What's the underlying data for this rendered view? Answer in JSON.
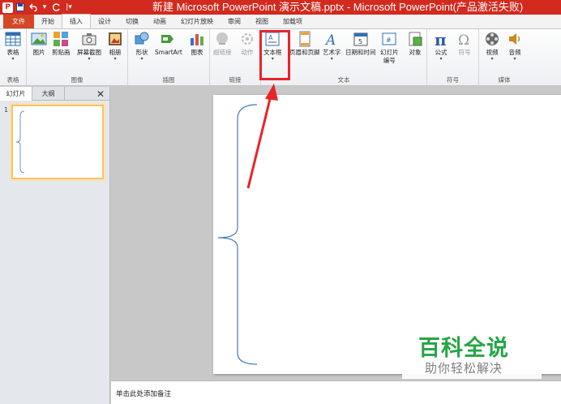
{
  "window": {
    "title": "新建 Microsoft PowerPoint 演示文稿.pptx - Microsoft PowerPoint(产品激活失败)",
    "app_logo": "P"
  },
  "quick_access": {
    "save_icon": "save-icon",
    "undo_icon": "undo-icon",
    "redo_icon": "redo-icon",
    "customize_icon": "customize-icon"
  },
  "tabs": [
    "文件",
    "开始",
    "插入",
    "设计",
    "切换",
    "动画",
    "幻灯片放映",
    "审阅",
    "视图",
    "加载项"
  ],
  "active_tab": "插入",
  "ribbon": {
    "groups": [
      {
        "label": "表格",
        "buttons": [
          {
            "label": "表格",
            "arrow": "▾"
          }
        ]
      },
      {
        "label": "图像",
        "buttons": [
          {
            "label": "图片"
          },
          {
            "label": "剪贴画"
          },
          {
            "label": "屏幕截图",
            "arrow": "▾"
          },
          {
            "label": "相册",
            "arrow": "▾"
          }
        ]
      },
      {
        "label": "插图",
        "buttons": [
          {
            "label": "形状",
            "arrow": "▾"
          },
          {
            "label": "SmartArt"
          },
          {
            "label": "图表"
          }
        ]
      },
      {
        "label": "链接",
        "buttons": [
          {
            "label": "超链接"
          },
          {
            "label": "动作"
          }
        ]
      },
      {
        "label": "文本",
        "buttons": [
          {
            "label": "文本框",
            "arrow": "▾"
          },
          {
            "label": "页眉和页脚"
          },
          {
            "label": "艺术字",
            "arrow": "▾"
          },
          {
            "label": "日期和时间"
          },
          {
            "label": "幻灯片\n编号"
          },
          {
            "label": "对象"
          }
        ]
      },
      {
        "label": "符号",
        "buttons": [
          {
            "label": "公式",
            "arrow": "▾"
          },
          {
            "label": "符号"
          }
        ]
      },
      {
        "label": "媒体",
        "buttons": [
          {
            "label": "视频",
            "arrow": "▾"
          },
          {
            "label": "音频",
            "arrow": "▾"
          }
        ]
      }
    ]
  },
  "left_panel": {
    "tabs": [
      "幻灯片",
      "大纲"
    ],
    "close_glyph": "✕",
    "slide_number": "1"
  },
  "notes": {
    "placeholder": "单击此处添加备注"
  },
  "watermark": {
    "main": "百科全说",
    "sub": "助你轻松解决"
  },
  "colors": {
    "title_bar": "#d22a1e",
    "file_tab": "#d24726",
    "highlight": "#e8242a",
    "watermark_green": "#26a545"
  }
}
